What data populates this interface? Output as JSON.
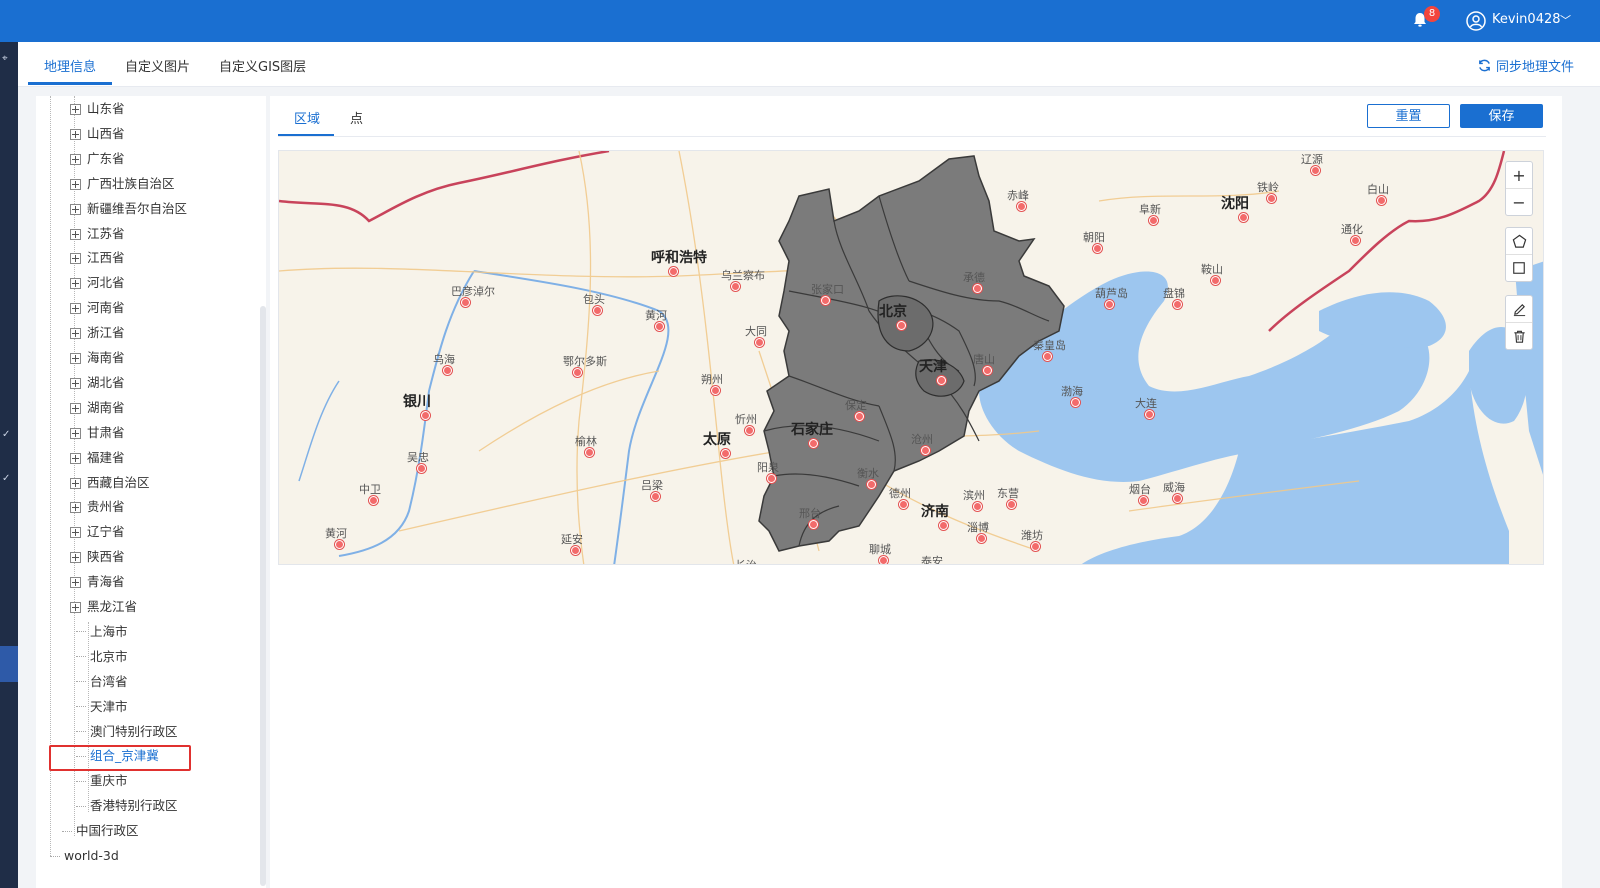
{
  "header": {
    "notification_count": "8",
    "username": "Kevin0428"
  },
  "tabs": [
    {
      "label": "地理信息",
      "active": true
    },
    {
      "label": "自定义图片",
      "active": false
    },
    {
      "label": "自定义GIS图层",
      "active": false
    }
  ],
  "sync_label": "同步地理文件",
  "tree": {
    "provinces": [
      "山东省",
      "山西省",
      "广东省",
      "广西壮族自治区",
      "新疆维吾尔自治区",
      "江苏省",
      "江西省",
      "河北省",
      "河南省",
      "浙江省",
      "海南省",
      "湖北省",
      "湖南省",
      "甘肃省",
      "福建省",
      "西藏自治区",
      "贵州省",
      "辽宁省",
      "陕西省",
      "青海省",
      "黑龙江省"
    ],
    "leaves": [
      "上海市",
      "北京市",
      "台湾省",
      "天津市",
      "澳门特别行政区",
      "组合_京津冀",
      "重庆市",
      "香港特别行政区"
    ],
    "selected": "组合_京津冀",
    "parent": "中国行政区",
    "root": "world-3d"
  },
  "sub_tabs": [
    {
      "label": "区域",
      "active": true
    },
    {
      "label": "点",
      "active": false
    }
  ],
  "buttons": {
    "reset": "重置",
    "save": "保存"
  },
  "map": {
    "controls": {
      "zoom_in": "+",
      "zoom_out": "−"
    },
    "region_fill": "#7b7b7b",
    "sea_color": "#9dc6ef",
    "land_color": "#f7f3ea",
    "labels": {
      "huhehaote": "呼和浩特",
      "wulanchabu": "乌兰察布",
      "bayannaoer": "巴彦淖尔",
      "baotou": "包头",
      "huanghe1": "黄河",
      "wuhai": "乌海",
      "eerduosi": "鄂尔多斯",
      "datong": "大同",
      "shuozhou": "朔州",
      "yinchuan": "银川",
      "xinzhou": "忻州",
      "taiyuan": "太原",
      "yulin": "榆林",
      "wuzhong": "吴忠",
      "zhongwei": "中卫",
      "lvliang": "吕梁",
      "yangquan": "阳泉",
      "huanghe2": "黄河",
      "yanan": "延安",
      "changzhi": "长治",
      "zhangjiakou": "张家口",
      "beijing": "北京",
      "chengde": "承德",
      "tangshan": "唐山",
      "tianjin": "天津",
      "baoding": "保定",
      "shijiazhuang": "石家庄",
      "cangzhou": "沧州",
      "hengshui": "衡水",
      "xingtai": "邢台",
      "chifeng": "赤峰",
      "fuxin": "阜新",
      "tieling": "铁岭",
      "shenyang": "沈阳",
      "chaoyang": "朝阳",
      "huludao": "葫芦岛",
      "panjin": "盘锦",
      "anshan": "鞍山",
      "tonghua": "通化",
      "baishan": "白山",
      "liaoyuan": "辽源",
      "qinhuangdao": "秦皇岛",
      "bohai": "渤海",
      "dalian": "大连",
      "dezhou": "德州",
      "binzhou": "滨州",
      "dongying": "东营",
      "jinan": "济南",
      "zibo": "淄博",
      "weifang": "潍坊",
      "yantai": "烟台",
      "weihai": "威海",
      "liaocheng": "聊城",
      "taian": "泰安"
    }
  }
}
